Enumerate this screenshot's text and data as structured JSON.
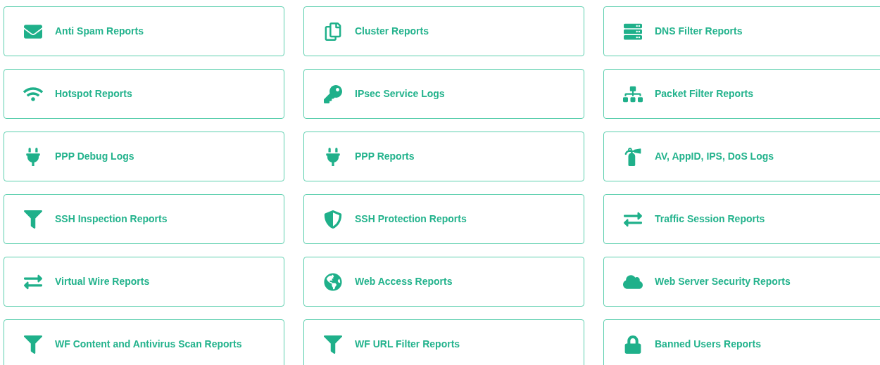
{
  "report_links": [
    {
      "label": "Anti Spam Reports"
    },
    {
      "label": "Cluster Reports"
    },
    {
      "label": "DNS Filter Reports"
    },
    {
      "label": "Hotspot Reports"
    },
    {
      "label": "IPsec Service Logs"
    },
    {
      "label": "Packet Filter Reports"
    },
    {
      "label": "PPP Debug Logs"
    },
    {
      "label": "PPP Reports"
    },
    {
      "label": "AV, AppID, IPS, DoS Logs"
    },
    {
      "label": "SSH Inspection Reports"
    },
    {
      "label": "SSH Protection Reports"
    },
    {
      "label": "Traffic Session Reports"
    },
    {
      "label": "Virtual Wire Reports"
    },
    {
      "label": "Web Access Reports"
    },
    {
      "label": "Web Server Security Reports"
    },
    {
      "label": "WF Content and Antivirus Scan Reports"
    },
    {
      "label": "WF URL Filter Reports"
    },
    {
      "label": "Banned Users Reports"
    }
  ]
}
